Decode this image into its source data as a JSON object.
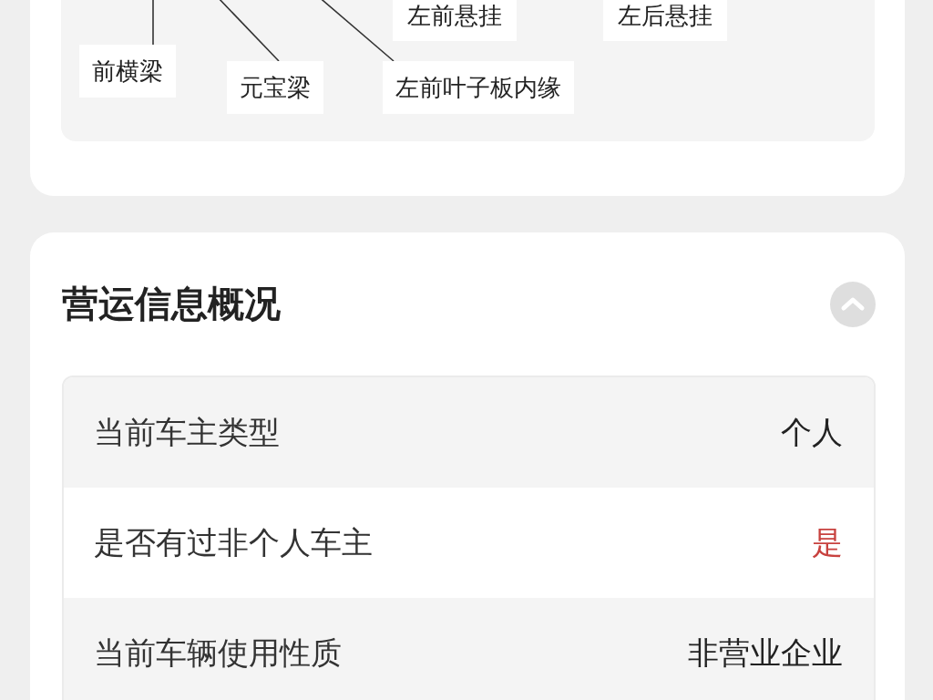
{
  "diagram": {
    "labels": [
      "左前悬挂",
      "左后悬挂",
      "前横梁",
      "元宝梁",
      "左前叶子板内缘"
    ]
  },
  "operation_info": {
    "title": "营运信息概况",
    "rows": [
      {
        "label": "当前车主类型",
        "value": "个人",
        "warning": false
      },
      {
        "label": "是否有过非个人车主",
        "value": "是",
        "warning": true
      },
      {
        "label": "当前车辆使用性质",
        "value": "非营业企业",
        "warning": false
      }
    ]
  }
}
